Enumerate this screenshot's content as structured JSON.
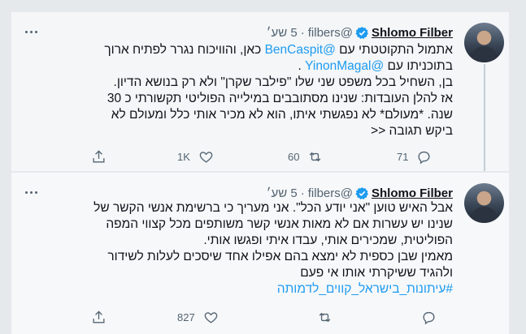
{
  "tweets": [
    {
      "author_name": "Shlomo Filber",
      "handle": "@filbers",
      "separator": "·",
      "time": "5 שע׳",
      "body_lines": [
        [
          "אתמול התקוטטתי עם ",
          {
            "mention": "@BenCaspit"
          },
          " כאן, והוויכוח נגרר לפתיח ארוך"
        ],
        [
          "בתוכניתו עם ",
          {
            "mention": "@YinonMagal"
          },
          " ."
        ],
        [
          "בן, השחיל בכל משפט שני שלו \"פילבר שקרן\" ולא רק בנושא הדיון."
        ],
        [
          "אז להלן העובדות: שנינו מסתובבים במילייה הפוליטי תקשורתי כ 30"
        ],
        [
          "שנה. *מעולם*  לא נפגשתי איתו, הוא לא מכיר אותי כלל ומעולם לא"
        ],
        [
          "ביקש תגובה <<"
        ]
      ],
      "reply_count": "",
      "retweet_count": "60",
      "like_count": "1K",
      "share_count": "71"
    },
    {
      "author_name": "Shlomo Filber",
      "handle": "@filbers",
      "separator": "·",
      "time": "5 שע׳",
      "body_lines": [
        [
          "אבל האיש טוען \"אני יודע הכל\". אני מעריך כי ברשימת אנשי הקשר של"
        ],
        [
          "שנינו יש עשרות אם לא מאות אנשי קשר משותפים מכל קצווי המפה"
        ],
        [
          "הפוליטית, שמכירים אותי, עבדו איתי ופגשו אותי."
        ],
        [
          "מאמין שבן כספית לא ימצא בהם אפילו אחד שיסכים לעלות לשידור"
        ],
        [
          "ולהגיד ששיקרתי אותו אי פעם"
        ],
        [
          {
            "hashtag": "#עיתונות_בישראל_קווים_לדמותה"
          }
        ]
      ],
      "reply_count": "",
      "retweet_count": "",
      "like_count": "827",
      "share_count": ""
    }
  ],
  "icons": {
    "more": "more-horizontal-icon",
    "verified": "verified-badge-icon",
    "reply": "reply-icon",
    "retweet": "retweet-icon",
    "like": "heart-icon",
    "share": "share-icon"
  },
  "colors": {
    "accent": "#1d9bf0",
    "text": "#0f1419",
    "muted": "#536471",
    "page_bg": "#e6e9ec"
  }
}
